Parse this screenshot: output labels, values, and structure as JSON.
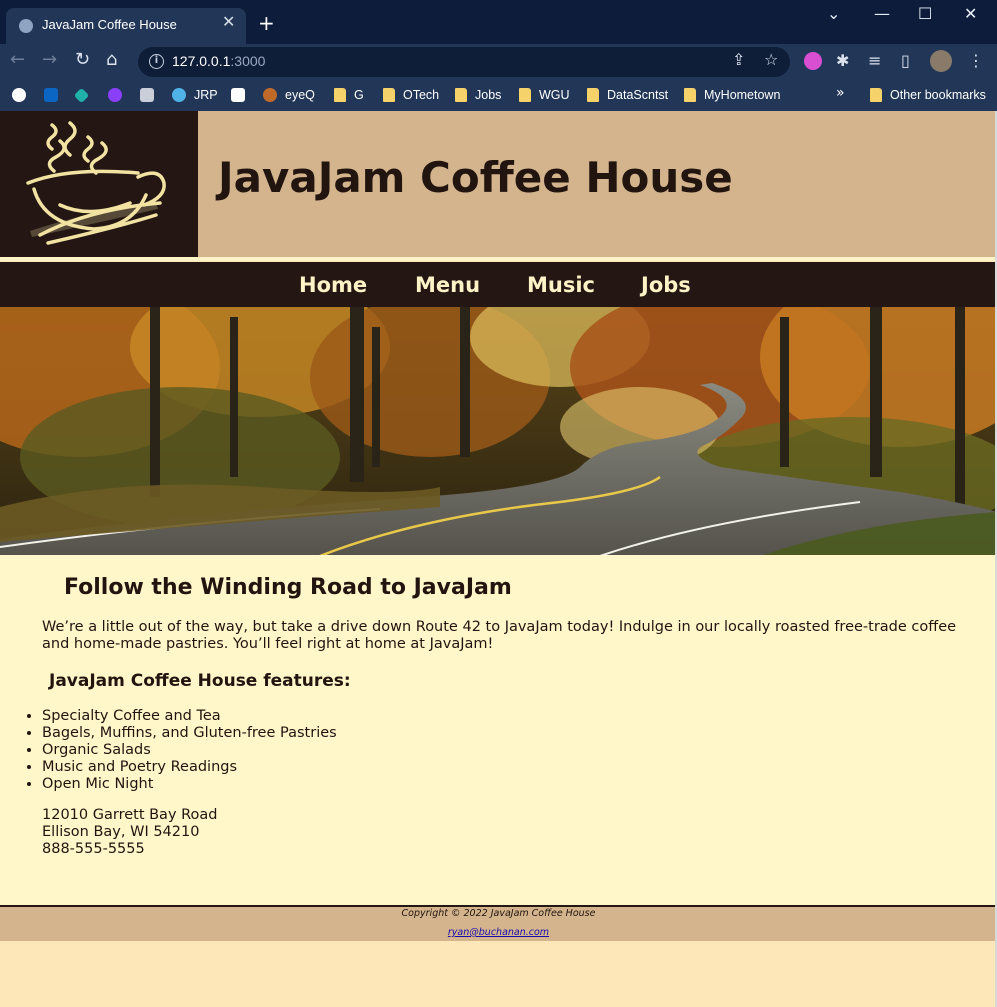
{
  "browser": {
    "tab_title": "JavaJam Coffee House",
    "tab_close": "✕",
    "new_tab": "+",
    "window_controls": {
      "minimize": "—",
      "maximize": "☐",
      "close": "✕",
      "tab_search": "⌄"
    },
    "url_host": "127.0.0.1",
    "url_port": ":3000",
    "bookmarks": [
      "JRP",
      "eyeQ",
      "G",
      "OTech",
      "Jobs",
      "WGU",
      "DataScntst",
      "MyHometown"
    ],
    "bookmarks_more": "»",
    "other_bookmarks": "Other bookmarks"
  },
  "site": {
    "title": "JavaJam Coffee House",
    "nav": [
      "Home",
      "Menu",
      "Music",
      "Jobs"
    ]
  },
  "content": {
    "heading": "Follow the Winding Road to JavaJam",
    "intro": "We’re a little out of the way, but take a drive down Route 42 to JavaJam today! Indulge in our locally roasted free-trade coffee and home-made pastries. You’ll feel right at home at JavaJam!",
    "features_heading": "JavaJam Coffee House features:",
    "features": [
      "Specialty Coffee and Tea",
      "Bagels, Muffins, and Gluten-free Pastries",
      "Organic Salads",
      "Music and Poetry Readings",
      "Open Mic Night"
    ],
    "address": {
      "street": "12010 Garrett Bay Road",
      "city": "Ellison Bay, WI 54210",
      "phone": "888-555-5555"
    }
  },
  "footer": {
    "copyright": "Copyright © 2022 JavaJam Coffee House",
    "email": "ryan@buchanan.com"
  },
  "colors": {
    "header_bg": "#d3b48c",
    "nav_bg": "#231613",
    "nav_text": "#fef3c6",
    "content_bg": "#fff6c9",
    "page_bg": "#fde7b9",
    "text": "#221510"
  }
}
